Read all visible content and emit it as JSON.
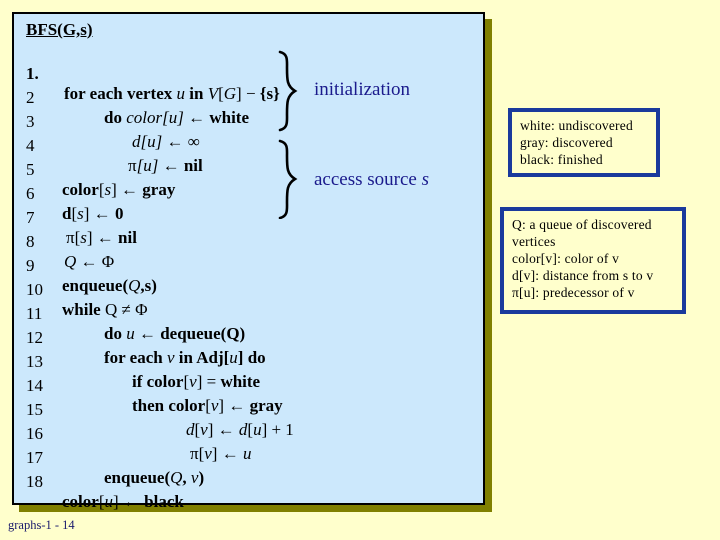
{
  "slide": {
    "footer": "graphs-1 - 14",
    "background_color": "#ffffcc",
    "panel_color": "#cce8fc",
    "panel_shadow_color": "#808000",
    "label_color": "#1a1a8c",
    "note_border_color": "#1a3a9c"
  },
  "algorithm": {
    "title": "BFS(G,s)",
    "lines": [
      {
        "number": "1.",
        "text": "for each vertex u in V[G] − {s}",
        "indent": 0
      },
      {
        "number": "2",
        "text": "do color[u] ← white",
        "indent": 1
      },
      {
        "number": "3",
        "text": "d[u] ← ∞",
        "indent": 2
      },
      {
        "number": "4",
        "text": "π[u] ← nil",
        "indent": 2
      },
      {
        "number": "5",
        "text": "color[s] ← gray",
        "indent": 0
      },
      {
        "number": "6",
        "text": "d[s] ← 0",
        "indent": 0
      },
      {
        "number": "7",
        "text": "π[s] ← nil",
        "indent": 0
      },
      {
        "number": "8",
        "text": "Q ← Φ",
        "indent": 0
      },
      {
        "number": "9",
        "text": "enqueue(Q,s)",
        "indent": 0
      },
      {
        "number": "10",
        "text": "while Q ≠ Φ",
        "indent": 0
      },
      {
        "number": "11",
        "text": "do u ← dequeue(Q)",
        "indent": 1
      },
      {
        "number": "12",
        "text": "for each v in Adj[u] do",
        "indent": 1
      },
      {
        "number": "13",
        "text": "if color[v] = white",
        "indent": 2
      },
      {
        "number": "14",
        "text": "then color[v] ← gray",
        "indent": 2
      },
      {
        "number": "15",
        "text": "d[v] ← d[u] + 1",
        "indent": 3
      },
      {
        "number": "16",
        "text": "π[v] ← u",
        "indent": 3
      },
      {
        "number": "17",
        "text": "enqueue(Q, v)",
        "indent": 1
      },
      {
        "number": "18",
        "text": "color[u] ← black",
        "indent": 0
      }
    ]
  },
  "annotations": [
    {
      "label": "initialization",
      "covers": "lines 1-4"
    },
    {
      "label": "access source s",
      "covers": "lines 5-9"
    }
  ],
  "notes": {
    "colors": {
      "lines": [
        "white: undiscovered",
        "gray: discovered",
        "black: finished"
      ]
    },
    "variables": {
      "lines": [
        "Q: a queue of discovered",
        "vertices",
        "color[v]: color of v",
        "d[v]: distance from s to v",
        "π[u]: predecessor of v"
      ]
    }
  }
}
